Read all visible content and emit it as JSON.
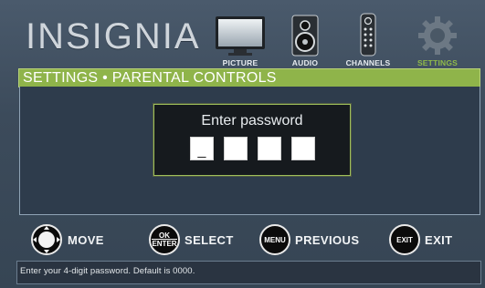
{
  "brand": {
    "logo_text": "INSIGNIA"
  },
  "menu": {
    "tabs": [
      {
        "label": "PICTURE",
        "icon": "tv-icon",
        "active": false
      },
      {
        "label": "AUDIO",
        "icon": "speaker-icon",
        "active": false
      },
      {
        "label": "CHANNELS",
        "icon": "remote-icon",
        "active": false
      },
      {
        "label": "SETTINGS",
        "icon": "gear-icon",
        "active": true
      }
    ]
  },
  "title_bar": {
    "text": "SETTINGS • PARENTAL CONTROLS"
  },
  "dialog": {
    "prompt": "Enter password",
    "pin_boxes": [
      "_",
      "",
      "",
      ""
    ]
  },
  "controls": [
    {
      "button": "",
      "label": "MOVE",
      "icon": "dpad-icon"
    },
    {
      "button_line1": "OK",
      "button_line2": "ENTER",
      "label": "SELECT"
    },
    {
      "button": "MENU",
      "label": "PREVIOUS"
    },
    {
      "button": "EXIT",
      "label": "EXIT"
    }
  ],
  "status": {
    "text": "Enter your 4-digit password. Default is 0000."
  },
  "colors": {
    "accent_green": "#8fb44a",
    "background": "#3c4b5b",
    "dialog_bg": "#161a1e"
  }
}
